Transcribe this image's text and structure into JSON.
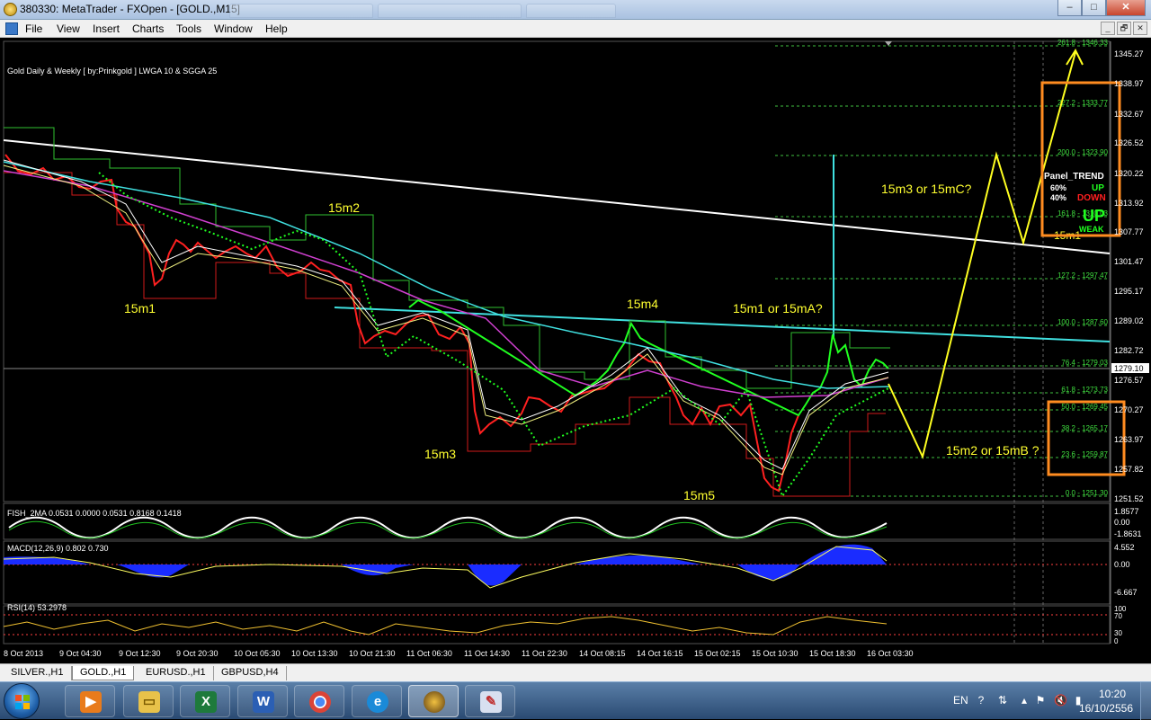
{
  "window": {
    "title": "380330: MetaTrader - FXOpen - [GOLD.,M15]",
    "buttons": [
      "–",
      "□",
      "✕"
    ]
  },
  "menu": {
    "items": [
      "File",
      "View",
      "Insert",
      "Charts",
      "Tools",
      "Window",
      "Help"
    ],
    "mdi_buttons": [
      "_",
      "🗗",
      "✕"
    ]
  },
  "chart": {
    "header": "Gold Daily & Weekly [ by:Prinkgold ] LWGA 10  &  SGGA 25",
    "current_price": "1279.10",
    "price_axis": [
      "1345.27",
      "1338.97",
      "1332.67",
      "1326.52",
      "1320.22",
      "1313.92",
      "1307.77",
      "1301.47",
      "1295.17",
      "1289.02",
      "1282.72",
      "1276.57",
      "1270.27",
      "1263.97",
      "1257.82",
      "1251.52"
    ],
    "fib_levels": [
      "261.8 - 1346.33",
      "227.2 - 1333.77",
      "200.0 - 1323.90",
      "161.8 - 1310.03",
      "127.2 - 1297.47",
      "100.0 - 1287.60",
      "76.4 - 1279.03",
      "61.8 - 1273.73",
      "50.0 - 1269.45",
      "38.2 - 1265.17",
      "23.6 - 1259.87",
      "0.0 - 1251.30"
    ],
    "annotations": {
      "m15_1": "15m1",
      "m15_2": "15m2",
      "m15_3": "15m3",
      "m15_4": "15m4",
      "m15_5": "15m5",
      "or_a": "15m1 or 15mA?",
      "or_c": "15m3 or 15mC?",
      "or_b": "15m2 or 15mB ?",
      "m15_ghost": "15m1"
    },
    "panel_trend": {
      "title": "Panel_TREND",
      "pct_up": "60%",
      "pct_down": "40%",
      "up": "UP",
      "down": "DOWN",
      "big": "UP",
      "weak": "WEAK"
    },
    "time_axis": [
      "8 Oct 2013",
      "9 Oct 04:30",
      "9 Oct 12:30",
      "9 Oct 20:30",
      "10 Oct 05:30",
      "10 Oct 13:30",
      "10 Oct 21:30",
      "11 Oct 06:30",
      "11 Oct 14:30",
      "11 Oct 22:30",
      "14 Oct 08:15",
      "14 Oct 16:15",
      "15 Oct 02:15",
      "15 Oct 10:30",
      "15 Oct 18:30",
      "16 Oct 03:30"
    ],
    "colors": {
      "bull": "#00ff00",
      "bear": "#ff0000",
      "accent_yellow": "#ffff00",
      "cyan": "#40e0e0",
      "orange_box": "#ff8c20"
    }
  },
  "indicators": {
    "fish": {
      "label": "FISH_2MA 0.0531 0.0000 0.0531 0.8168 0.1418",
      "axis": [
        "1.8577",
        "0.00",
        "-1.8631"
      ]
    },
    "macd": {
      "label": "MACD(12,26,9) 0.802 0.730",
      "axis": [
        "4.552",
        "0.00",
        "-6.667"
      ]
    },
    "rsi": {
      "label": "RSI(14) 53.2978",
      "axis": [
        "100",
        "70",
        "30",
        "0"
      ]
    }
  },
  "tabs": [
    "SILVER.,H1",
    "GOLD.,H1",
    "EURUSD.,H1",
    "GBPUSD,H4"
  ],
  "active_tab": "GOLD.,H1",
  "taskbar": {
    "apps": [
      "media-player",
      "file-explorer",
      "excel",
      "word",
      "chrome",
      "internet-explorer",
      "metatrader",
      "paint"
    ],
    "lang": "EN",
    "time": "10:20",
    "date": "16/10/2556"
  }
}
